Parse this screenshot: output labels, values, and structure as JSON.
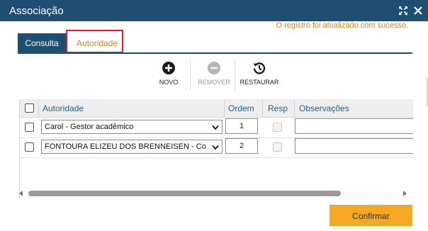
{
  "window": {
    "title": "Associação",
    "maximize_icon": "expand-arrows-icon",
    "close_icon": "close-x-icon"
  },
  "status_message": "O registro foi atualizado com sucesso.",
  "tabs": [
    {
      "label": "Consulta",
      "active": false
    },
    {
      "label": "Autoridade",
      "active": true
    }
  ],
  "toolbar": {
    "new_label": "NOVO",
    "remove_label": "REMOVER",
    "restore_label": "RESTAURAR",
    "remove_disabled": true
  },
  "grid": {
    "columns": {
      "autoridade": "Autoridade",
      "ordem": "Ordem",
      "resp": "Resp",
      "observacoes": "Observações"
    },
    "rows": [
      {
        "autoridade": "Carol - Gestor acadêmico",
        "ordem": "1",
        "resp": false,
        "observacoes": ""
      },
      {
        "autoridade": "FONTOURA ELIZEU DOS BRENNEISEN - Coordenador",
        "ordem": "2",
        "resp": false,
        "observacoes": ""
      }
    ]
  },
  "confirm_label": "Confirmar",
  "colors": {
    "header": "#1e4f72",
    "accent_orange": "#e0801a",
    "confirm_button": "#f7a823",
    "highlight_red": "#d6202c"
  }
}
